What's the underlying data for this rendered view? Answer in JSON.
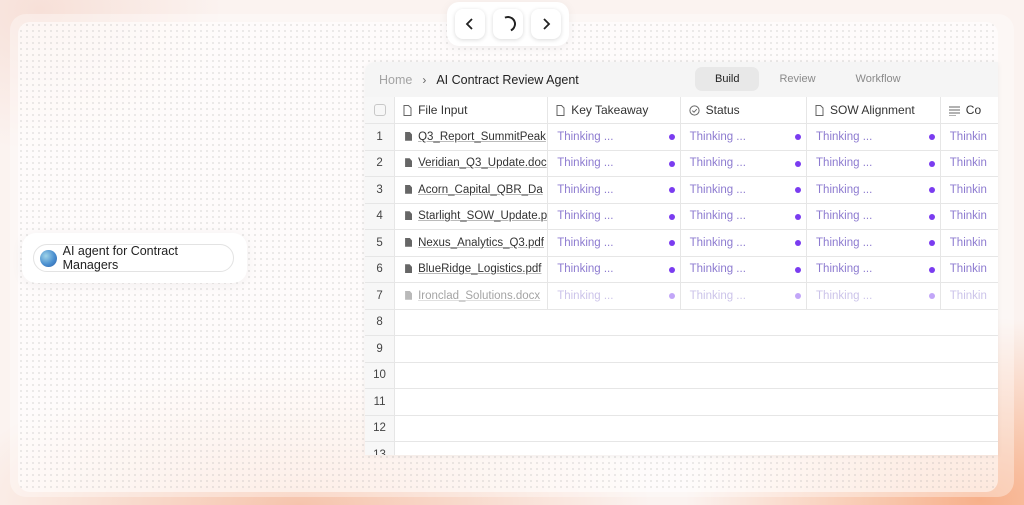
{
  "nav": {
    "prev_icon": "chevron-left-icon",
    "loading_icon": "spinner-icon",
    "next_icon": "chevron-right-icon"
  },
  "agent": {
    "label": "AI agent for Contract Managers"
  },
  "breadcrumb": {
    "home": "Home",
    "title": "AI Contract Review Agent"
  },
  "modes": [
    {
      "label": "Build",
      "active": true
    },
    {
      "label": "Review",
      "active": false
    },
    {
      "label": "Workflow",
      "active": false
    }
  ],
  "columns": [
    {
      "label": "File Input",
      "icon": "document-icon"
    },
    {
      "label": "Key Takeaway",
      "icon": "document-icon"
    },
    {
      "label": "Status",
      "icon": "check-circle-icon"
    },
    {
      "label": "SOW Alignment",
      "icon": "document-icon"
    },
    {
      "label": "Co",
      "icon": "text-lines-icon"
    }
  ],
  "rows": [
    {
      "n": "1",
      "file": "Q3_Report_SummitPeak",
      "c1": "Thinking ...",
      "c2": "Thinking ...",
      "c3": "Thinking ...",
      "c4": "Thinkin"
    },
    {
      "n": "2",
      "file": "Veridian_Q3_Update.doc",
      "c1": "Thinking ...",
      "c2": "Thinking ...",
      "c3": "Thinking ...",
      "c4": "Thinkin"
    },
    {
      "n": "3",
      "file": "Acorn_Capital_QBR_Da",
      "c1": "Thinking ...",
      "c2": "Thinking ...",
      "c3": "Thinking ...",
      "c4": "Thinkin"
    },
    {
      "n": "4",
      "file": "Starlight_SOW_Update.p",
      "c1": "Thinking ...",
      "c2": "Thinking ...",
      "c3": "Thinking ...",
      "c4": "Thinkin"
    },
    {
      "n": "5",
      "file": "Nexus_Analytics_Q3.pdf",
      "c1": "Thinking ...",
      "c2": "Thinking ...",
      "c3": "Thinking ...",
      "c4": "Thinkin"
    },
    {
      "n": "6",
      "file": "BlueRidge_Logistics.pdf",
      "c1": "Thinking ...",
      "c2": "Thinking ...",
      "c3": "Thinking ...",
      "c4": "Thinkin"
    },
    {
      "n": "7",
      "file": "Ironclad_Solutions.docx",
      "c1": "Thinking ...",
      "c2": "Thinking ...",
      "c3": "Thinking ...",
      "c4": "Thinkin"
    }
  ],
  "empty_rows": [
    "8",
    "9",
    "10",
    "11",
    "12",
    "13"
  ],
  "colors": {
    "accent_dot": "#7a3cf0",
    "thinking_text": "#8d7bd0"
  }
}
